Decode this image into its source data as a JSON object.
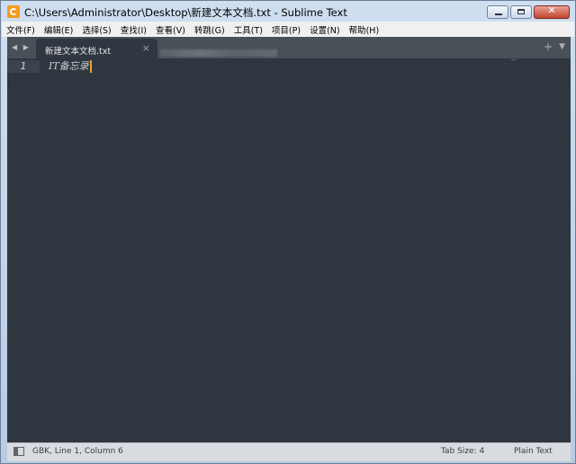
{
  "window": {
    "title": "C:\\Users\\Administrator\\Desktop\\新建文本文档.txt - Sublime Text",
    "controls": {
      "minimize": "",
      "maximize": "",
      "close": "✕"
    }
  },
  "menu": [
    "文件(F)",
    "编辑(E)",
    "选择(S)",
    "查找(I)",
    "查看(V)",
    "转跳(G)",
    "工具(T)",
    "项目(P)",
    "设置(N)",
    "帮助(H)"
  ],
  "tabs": {
    "nav_arrows": "◀ ▶",
    "active_tab": {
      "label": "新建文本文档.txt",
      "close": "×"
    },
    "new_tab": "+",
    "tab_menu": "▼"
  },
  "editor": {
    "lines": [
      {
        "number": "1",
        "text": "IT备忘录"
      }
    ]
  },
  "status": {
    "left": "GBK, Line 1, Column 6",
    "tab_size": "Tab Size: 4",
    "syntax": "Plain Text"
  },
  "colors": {
    "editor_bg": "#2f363f",
    "tab_bar_bg": "#4a5058",
    "caret": "#f0a030",
    "status_bg": "#d8dbdf"
  }
}
